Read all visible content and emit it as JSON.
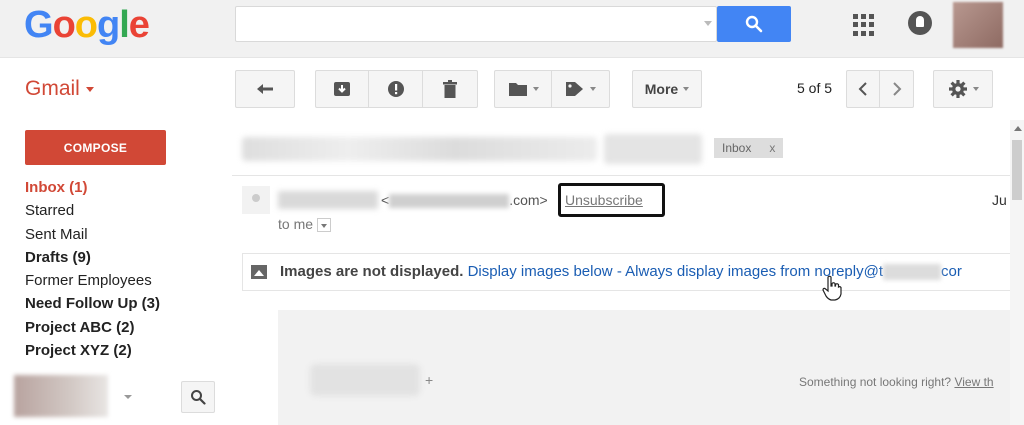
{
  "header": {
    "logo_letters": [
      "G",
      "o",
      "o",
      "g",
      "l",
      "e"
    ],
    "logo_colors": [
      "#4285f4",
      "#ea4335",
      "#fbbc05",
      "#4285f4",
      "#34a853",
      "#ea4335"
    ],
    "search": {
      "value": "",
      "placeholder": ""
    }
  },
  "toolbar": {
    "gmail_label": "Gmail",
    "more_label": "More",
    "pager_text": "5 of 5"
  },
  "sidebar": {
    "compose_label": "COMPOSE",
    "items": [
      {
        "label": "Inbox (1)",
        "style": "active"
      },
      {
        "label": "Starred",
        "style": "normal"
      },
      {
        "label": "Sent Mail",
        "style": "normal"
      },
      {
        "label": "Drafts (9)",
        "style": "bold"
      },
      {
        "label": "Former Employees",
        "style": "normal"
      },
      {
        "label": "Need Follow Up (3)",
        "style": "bold"
      },
      {
        "label": "Project ABC (2)",
        "style": "bold"
      },
      {
        "label": "Project XYZ (2)",
        "style": "bold"
      }
    ]
  },
  "message": {
    "label_chip": "Inbox",
    "label_chip_close": "x",
    "sender_email_prefix": "<",
    "sender_email_suffix": ".com>",
    "unsubscribe_label": "Unsubscribe",
    "date_text": "Ju",
    "to_me_label": "to me",
    "images_notice_bold": "Images are not displayed.",
    "display_below_link": "Display images below",
    "separator": " - ",
    "always_display_link": "Always display images from noreply@t",
    "always_display_tail": "cor",
    "body_plus": "+",
    "not_right_text": "Something not looking right?",
    "view_link": "View th"
  },
  "colors": {
    "gmail_red": "#d14836",
    "search_blue": "#4285f4",
    "link_blue": "#1a5db3"
  }
}
